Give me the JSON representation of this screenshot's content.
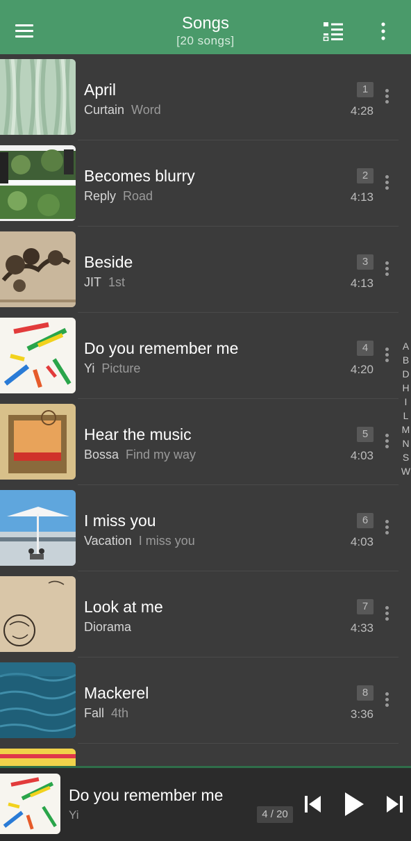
{
  "header": {
    "title": "Songs",
    "subtitle": "[20 songs]",
    "accent_color": "#4a9a6a",
    "icons": [
      "hamburger-menu-icon",
      "list-view-icon",
      "more-vertical-icon"
    ]
  },
  "songs": [
    {
      "title": "April",
      "artist": "Curtain",
      "album": "Word",
      "number": "1",
      "duration": "4:28",
      "cover": "green-curtain"
    },
    {
      "title": "Becomes blurry",
      "artist": "Reply",
      "album": "Road",
      "number": "2",
      "duration": "4:13",
      "cover": "forest-photo"
    },
    {
      "title": "Beside",
      "artist": "JIT",
      "album": "1st",
      "number": "3",
      "duration": "4:13",
      "cover": "tree-sketch"
    },
    {
      "title": "Do you remember me",
      "artist": "Yi",
      "album": "Picture",
      "number": "4",
      "duration": "4:20",
      "cover": "paint-strokes"
    },
    {
      "title": "Hear the music",
      "artist": "Bossa",
      "album": "Find my way",
      "number": "5",
      "duration": "4:03",
      "cover": "orange-frame"
    },
    {
      "title": "I miss you",
      "artist": "Vacation",
      "album": "I miss you",
      "number": "6",
      "duration": "4:03",
      "cover": "beach-umbrella"
    },
    {
      "title": "Look at me",
      "artist": "Diorama",
      "album": "",
      "number": "7",
      "duration": "4:33",
      "cover": "beige-doodle"
    },
    {
      "title": "Mackerel",
      "artist": "Fall",
      "album": "4th",
      "number": "8",
      "duration": "3:36",
      "cover": "blue-water"
    }
  ],
  "index_letters": [
    "A",
    "B",
    "D",
    "H",
    "I",
    "L",
    "M",
    "N",
    "S",
    "W"
  ],
  "now_playing": {
    "title": "Do you remember me",
    "artist": "Yi",
    "position": "4 / 20",
    "controls": [
      "previous-icon",
      "play-icon",
      "next-icon"
    ]
  }
}
